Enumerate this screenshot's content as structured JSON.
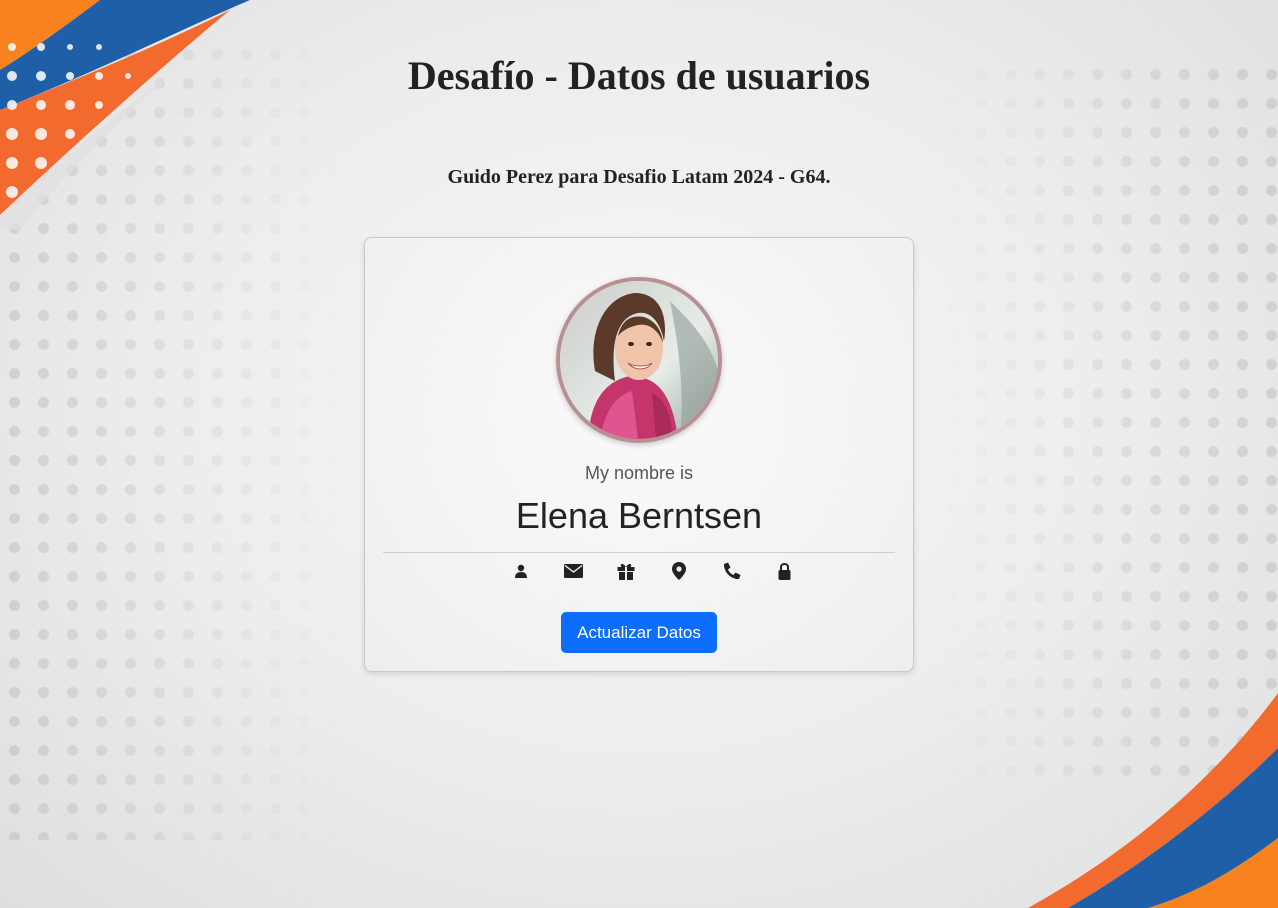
{
  "page": {
    "title": "Desafío - Datos de usuarios",
    "subtitle": "Guido Perez para Desafio Latam 2024 - G64."
  },
  "card": {
    "name_label": "My nombre is",
    "name": "Elena Berntsen",
    "icons": [
      "user-icon",
      "envelope-icon",
      "gift-icon",
      "map-marker-icon",
      "phone-icon",
      "lock-icon"
    ],
    "button_label": "Actualizar Datos"
  },
  "colors": {
    "accent_orange": "#f26a2e",
    "accent_blue": "#1f5fa8",
    "button_blue": "#0d6efd",
    "avatar_border": "#b89093"
  }
}
